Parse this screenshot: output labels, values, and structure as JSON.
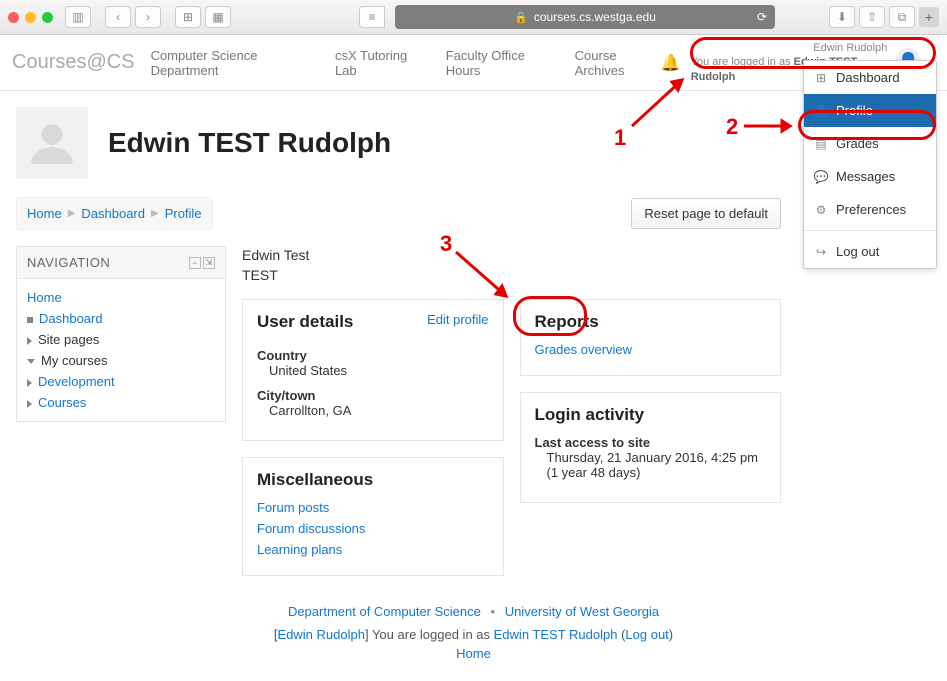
{
  "browser": {
    "url": "courses.cs.westga.edu"
  },
  "topbar": {
    "brand": "Courses@CS",
    "links": [
      "Computer Science Department",
      "csX Tutoring Lab",
      "Faculty Office Hours",
      "Course Archives"
    ],
    "user_name": "Edwin Rudolph",
    "logged_in_prefix": "You are logged in as ",
    "logged_in_name": "Edwin TEST Rudolph"
  },
  "dropdown": {
    "items": [
      {
        "icon": "⊞",
        "label": "Dashboard"
      },
      {
        "icon": "👤",
        "label": "Profile",
        "selected": true
      },
      {
        "icon": "▤",
        "label": "Grades"
      },
      {
        "icon": "💬",
        "label": "Messages"
      },
      {
        "icon": "⚙",
        "label": "Preferences"
      }
    ],
    "logout_icon": "↪",
    "logout": "Log out"
  },
  "annotations": {
    "n1": "1",
    "n2": "2",
    "n3": "3"
  },
  "profile": {
    "name": "Edwin TEST Rudolph"
  },
  "breadcrumb": {
    "home": "Home",
    "dash": "Dashboard",
    "prof": "Profile"
  },
  "reset_btn": "Reset page to default",
  "nav": {
    "title": "NAVIGATION",
    "home": "Home",
    "dashboard": "Dashboard",
    "site_pages": "Site pages",
    "my_courses": "My courses",
    "development": "Development",
    "courses": "Courses"
  },
  "summary": {
    "l1": "Edwin Test",
    "l2": "TEST"
  },
  "user_details": {
    "title": "User details",
    "edit": "Edit profile",
    "country_k": "Country",
    "country_v": "United States",
    "city_k": "City/town",
    "city_v": "Carrollton, GA"
  },
  "misc": {
    "title": "Miscellaneous",
    "forum_posts": "Forum posts",
    "forum_disc": "Forum discussions",
    "learning": "Learning plans"
  },
  "reports": {
    "title": "Reports",
    "grades": "Grades overview"
  },
  "login_activity": {
    "title": "Login activity",
    "k": "Last access to site",
    "v": "Thursday, 21 January 2016, 4:25 pm  (1 year 48 days)"
  },
  "footer": {
    "dept": "Department of Computer Science",
    "uni": "University of West Georgia",
    "bracket_open": "[",
    "real_name": "Edwin Rudolph",
    "bracket_close": "]",
    "mid": " You are logged in as ",
    "test_name": "Edwin TEST Rudolph",
    "open_paren": " (",
    "logout": "Log out",
    "close_paren": ")",
    "home": "Home"
  }
}
